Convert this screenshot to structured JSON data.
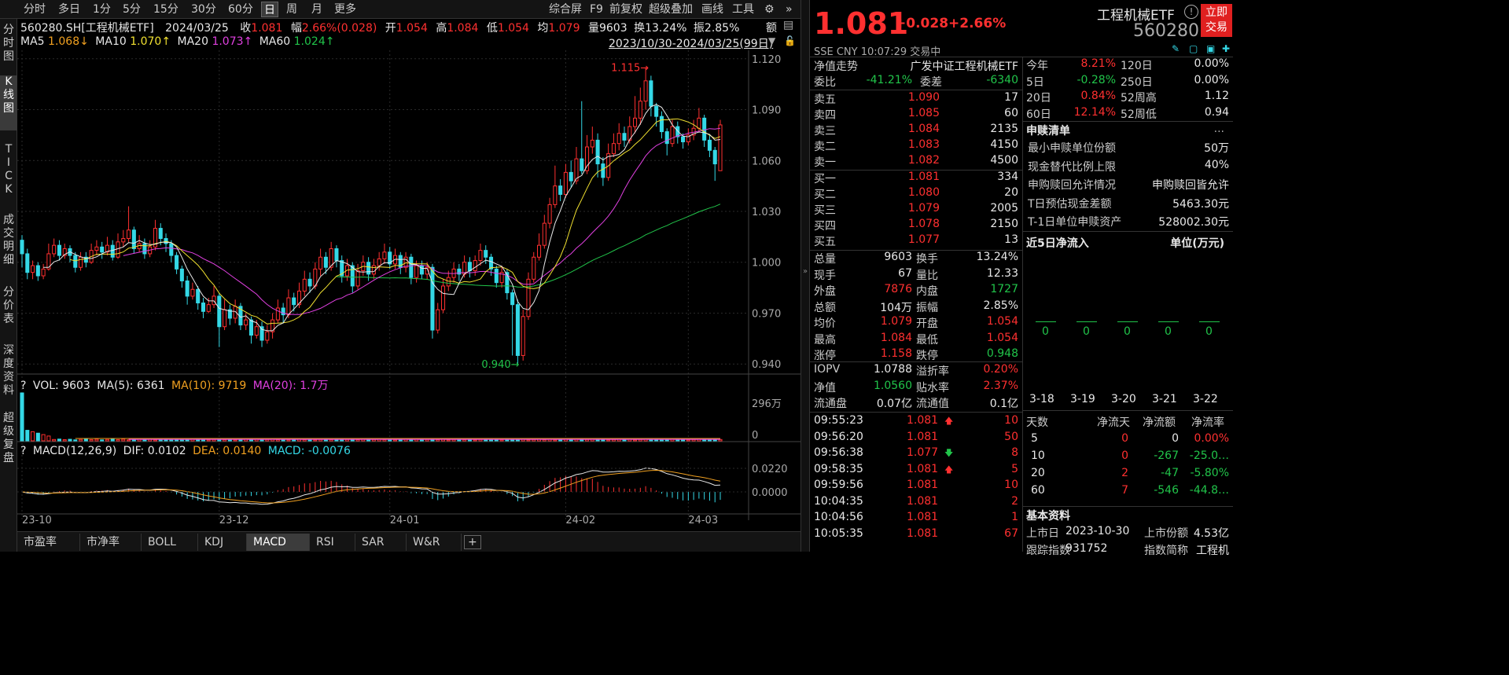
{
  "toolbar": {
    "left_tabs": [
      "分时",
      "多日",
      "1分",
      "5分",
      "15分",
      "30分",
      "60分",
      "日",
      "周",
      "月",
      "更多"
    ],
    "active_tab": "日",
    "right_tabs": [
      "综合屏",
      "F9",
      "前复权",
      "超级叠加",
      "画线",
      "工具"
    ]
  },
  "side_tabs": [
    "分时图",
    "K线图",
    "TICK",
    "成交明细",
    "分价表",
    "深度资料",
    "超级复盘"
  ],
  "quote_line": {
    "code": "560280.SH[工程机械ETF]",
    "date": "2024/03/25",
    "close_label": "收",
    "close": "1.081",
    "amp_label": "幅",
    "amp": "2.66%(0.028)",
    "open_label": "开",
    "open": "1.054",
    "high_label": "高",
    "high": "1.084",
    "low_label": "低",
    "low": "1.054",
    "avg_label": "均",
    "avg": "1.079",
    "vol_label": "量",
    "vol": "9603",
    "turn_label": "换",
    "turn": "13.24%",
    "swing_label": "振",
    "swing": "2.85%",
    "amt_label": "额"
  },
  "ma_line": {
    "ma5": "MA5",
    "ma5_val": "1.068↓",
    "ma10": "MA10",
    "ma10_val": "1.070↑",
    "ma20": "MA20",
    "ma20_val": "1.073↑",
    "ma60": "MA60",
    "ma60_val": "1.024↑",
    "range": "2023/10/30-2024/03/25(99日)"
  },
  "vol_line": {
    "q": "?",
    "vol": "VOL: 9603",
    "ma5": "MA(5): 6361",
    "ma10": "MA(10): 9719",
    "ma20": "MA(20): 1.7万"
  },
  "macd_line": {
    "q": "?",
    "name": "MACD(12,26,9)",
    "dif": "DIF: 0.0102",
    "dea": "DEA: 0.0140",
    "macd": "MACD: -0.0076"
  },
  "bottom_tabs": [
    "市盈率",
    "市净率",
    "BOLL",
    "KDJ",
    "MACD",
    "RSI",
    "SAR",
    "W&R"
  ],
  "active_bottom": "MACD",
  "chart_data": {
    "type": "candlestick",
    "y_ticks": [
      "1.120",
      "1.090",
      "1.060",
      "1.030",
      "1.000",
      "0.970",
      "0.940"
    ],
    "ylim": [
      0.935,
      1.125
    ],
    "x_ticks": [
      "23-10",
      "23-12",
      "24-01",
      "24-02",
      "24-03"
    ],
    "x_tick_index": [
      0,
      37,
      69,
      102,
      125
    ],
    "high_label": "1.115",
    "low_label": "0.940",
    "vol_ticks": [
      "296万",
      "0"
    ],
    "macd_ticks": [
      "0.0220",
      "0.0000"
    ],
    "candles": [
      [
        1.013,
        1.005,
        1.016,
        0.997
      ],
      [
        1.005,
        0.994,
        1.008,
        0.99
      ],
      [
        0.994,
        0.998,
        1.001,
        0.99
      ],
      [
        0.998,
        0.992,
        1.0,
        0.989
      ],
      [
        0.992,
        0.996,
        0.999,
        0.99
      ],
      [
        0.996,
        1.005,
        1.011,
        0.995
      ],
      [
        1.005,
        1.01,
        1.014,
        1.003
      ],
      [
        1.01,
        1.004,
        1.013,
        1.001
      ],
      [
        1.004,
        1.008,
        1.011,
        1.002
      ],
      [
        1.008,
        1.004,
        1.01,
        1.0
      ],
      [
        1.004,
        0.997,
        1.006,
        0.994
      ],
      [
        0.997,
        1.003,
        1.006,
        0.995
      ],
      [
        1.003,
        1.0,
        1.006,
        0.997
      ],
      [
        1.0,
        1.007,
        1.011,
        0.999
      ],
      [
        1.007,
        1.009,
        1.013,
        1.004
      ],
      [
        1.009,
        1.006,
        1.012,
        1.002
      ],
      [
        1.006,
        1.01,
        1.015,
        1.004
      ],
      [
        1.01,
        1.003,
        1.013,
        1.001
      ],
      [
        1.003,
        1.012,
        1.017,
        1.002
      ],
      [
        1.012,
        1.014,
        1.019,
        1.009
      ],
      [
        1.014,
        1.019,
        1.033,
        1.012
      ],
      [
        1.019,
        1.008,
        1.021,
        1.005
      ],
      [
        1.008,
        1.011,
        1.016,
        1.006
      ],
      [
        1.011,
        1.005,
        1.014,
        1.002
      ],
      [
        1.005,
        1.009,
        1.013,
        1.003
      ],
      [
        1.009,
        1.02,
        1.025,
        1.007
      ],
      [
        1.02,
        1.014,
        1.023,
        1.01
      ],
      [
        1.014,
        1.011,
        1.017,
        1.006
      ],
      [
        1.011,
        1.004,
        1.013,
        1.0
      ],
      [
        1.004,
        0.996,
        1.006,
        0.993
      ],
      [
        0.996,
        0.989,
        0.998,
        0.985
      ],
      [
        0.989,
        0.98,
        0.992,
        0.975
      ],
      [
        0.98,
        0.984,
        0.988,
        0.978
      ],
      [
        0.984,
        0.976,
        0.986,
        0.972
      ],
      [
        0.976,
        0.971,
        0.979,
        0.967
      ],
      [
        0.971,
        0.975,
        0.979,
        0.97
      ],
      [
        0.975,
        0.98,
        0.986,
        0.973
      ],
      [
        0.98,
        0.962,
        0.982,
        0.95
      ],
      [
        0.962,
        0.972,
        0.978,
        0.96
      ],
      [
        0.972,
        0.967,
        0.975,
        0.963
      ],
      [
        0.967,
        0.974,
        0.978,
        0.964
      ],
      [
        0.974,
        0.963,
        0.976,
        0.96
      ],
      [
        0.963,
        0.966,
        0.97,
        0.96
      ],
      [
        0.966,
        0.957,
        0.968,
        0.952
      ],
      [
        0.957,
        0.962,
        0.966,
        0.955
      ],
      [
        0.962,
        0.954,
        0.965,
        0.95
      ],
      [
        0.954,
        0.959,
        0.963,
        0.952
      ],
      [
        0.959,
        0.966,
        0.97,
        0.955
      ],
      [
        0.966,
        0.973,
        0.978,
        0.964
      ],
      [
        0.973,
        0.969,
        0.976,
        0.964
      ],
      [
        0.969,
        0.979,
        0.984,
        0.967
      ],
      [
        0.979,
        0.975,
        0.982,
        0.971
      ],
      [
        0.975,
        0.983,
        0.988,
        0.973
      ],
      [
        0.983,
        0.99,
        0.995,
        0.98
      ],
      [
        0.99,
        0.986,
        0.994,
        0.982
      ],
      [
        0.986,
        0.996,
        1.0,
        0.984
      ],
      [
        0.996,
        1.003,
        1.008,
        0.992
      ],
      [
        1.003,
        0.997,
        1.006,
        0.993
      ],
      [
        0.997,
        1.008,
        1.012,
        0.995
      ],
      [
        1.008,
        1.001,
        1.01,
        0.997
      ],
      [
        1.001,
        0.992,
        1.004,
        0.988
      ],
      [
        0.992,
        0.998,
        1.002,
        0.989
      ],
      [
        0.998,
        0.986,
        1.0,
        0.982
      ],
      [
        0.986,
        0.995,
        0.999,
        0.984
      ],
      [
        0.995,
        1.0,
        1.004,
        0.992
      ],
      [
        1.0,
        0.993,
        1.003,
        0.989
      ],
      [
        0.993,
        0.998,
        1.002,
        0.99
      ],
      [
        0.998,
        1.002,
        1.006,
        0.995
      ],
      [
        1.002,
        1.006,
        1.011,
        0.999
      ],
      [
        1.006,
        0.999,
        1.009,
        0.996
      ],
      [
        0.999,
        1.004,
        1.008,
        0.996
      ],
      [
        1.004,
        0.997,
        1.006,
        0.993
      ],
      [
        0.997,
        1.003,
        1.006,
        0.994
      ],
      [
        1.003,
        0.991,
        1.005,
        0.987
      ],
      [
        0.991,
        0.998,
        1.001,
        0.988
      ],
      [
        0.998,
        0.993,
        1.001,
        0.99
      ],
      [
        0.993,
        0.997,
        1.0,
        0.99
      ],
      [
        0.997,
        0.96,
        0.999,
        0.955
      ],
      [
        0.96,
        0.972,
        0.976,
        0.958
      ],
      [
        0.972,
        0.986,
        0.99,
        0.97
      ],
      [
        0.986,
        0.991,
        0.995,
        0.983
      ],
      [
        0.991,
        0.996,
        1.0,
        0.988
      ],
      [
        0.996,
        0.993,
        0.999,
        0.989
      ],
      [
        0.993,
        1.0,
        1.004,
        0.991
      ],
      [
        1.0,
        0.995,
        1.003,
        0.991
      ],
      [
        0.995,
        1.001,
        1.004,
        0.992
      ],
      [
        1.001,
        1.007,
        1.011,
        0.998
      ],
      [
        1.007,
        1.003,
        1.01,
        0.999
      ],
      [
        1.003,
        0.996,
        1.005,
        0.992
      ],
      [
        0.996,
        0.988,
        0.998,
        0.985
      ],
      [
        0.988,
        0.994,
        0.998,
        0.985
      ],
      [
        0.994,
        0.982,
        0.996,
        0.978
      ],
      [
        0.982,
        0.975,
        0.984,
        0.945
      ],
      [
        0.975,
        0.945,
        0.978,
        0.94
      ],
      [
        0.945,
        0.968,
        0.972,
        0.942
      ],
      [
        0.968,
        0.99,
        0.994,
        0.966
      ],
      [
        0.99,
        1.003,
        1.006,
        0.988
      ],
      [
        1.003,
        1.01,
        1.017,
        1.001
      ],
      [
        1.01,
        1.023,
        1.028,
        1.008
      ],
      [
        1.023,
        1.034,
        1.038,
        1.02
      ],
      [
        1.034,
        1.045,
        1.057,
        1.032
      ],
      [
        1.045,
        1.04,
        1.049,
        1.036
      ],
      [
        1.04,
        1.053,
        1.058,
        1.038
      ],
      [
        1.053,
        1.048,
        1.06,
        1.044
      ],
      [
        1.048,
        1.061,
        1.068,
        1.046
      ],
      [
        1.061,
        1.054,
        1.095,
        1.052
      ],
      [
        1.054,
        1.068,
        1.075,
        1.052
      ],
      [
        1.068,
        1.072,
        1.08,
        1.064
      ],
      [
        1.072,
        1.058,
        1.076,
        1.05
      ],
      [
        1.058,
        1.05,
        1.062,
        1.045
      ],
      [
        1.05,
        1.064,
        1.07,
        1.048
      ],
      [
        1.064,
        1.07,
        1.076,
        1.062
      ],
      [
        1.07,
        1.076,
        1.082,
        1.066
      ],
      [
        1.076,
        1.072,
        1.08,
        1.068
      ],
      [
        1.072,
        1.08,
        1.086,
        1.07
      ],
      [
        1.08,
        1.085,
        1.098,
        1.076
      ],
      [
        1.085,
        1.095,
        1.103,
        1.081
      ],
      [
        1.095,
        1.107,
        1.115,
        1.09
      ],
      [
        1.107,
        1.092,
        1.11,
        1.086
      ],
      [
        1.092,
        1.086,
        1.094,
        1.08
      ],
      [
        1.086,
        1.077,
        1.089,
        1.073
      ],
      [
        1.077,
        1.07,
        1.079,
        1.063
      ],
      [
        1.07,
        1.08,
        1.084,
        1.068
      ],
      [
        1.08,
        1.074,
        1.083,
        1.07
      ],
      [
        1.074,
        1.071,
        1.076,
        1.067
      ],
      [
        1.071,
        1.075,
        1.079,
        1.069
      ],
      [
        1.075,
        1.079,
        1.084,
        1.072
      ],
      [
        1.079,
        1.085,
        1.091,
        1.077
      ],
      [
        1.085,
        1.072,
        1.087,
        1.068
      ],
      [
        1.072,
        1.066,
        1.075,
        1.062
      ],
      [
        1.066,
        1.058,
        1.068,
        1.048
      ],
      [
        1.054,
        1.081,
        1.084,
        1.054
      ]
    ]
  },
  "rp": {
    "price": "1.081",
    "change": "+0.028",
    "change_pct": "+2.66%",
    "name": "工程机械ETF",
    "code": "560280",
    "trade_btn": "立即交易",
    "sub": "SSE  CNY  10:07:29  交易中",
    "nav_label": "净值走势",
    "fund_full": "广发中证工程机械ETF",
    "wb_label": "委比",
    "wb": "-41.21%",
    "wc_label": "委差",
    "wc": "-6340",
    "asks": [
      {
        "label": "卖五",
        "price": "1.090",
        "vol": "17"
      },
      {
        "label": "卖四",
        "price": "1.085",
        "vol": "60"
      },
      {
        "label": "卖三",
        "price": "1.084",
        "vol": "2135"
      },
      {
        "label": "卖二",
        "price": "1.083",
        "vol": "4150"
      },
      {
        "label": "卖一",
        "price": "1.082",
        "vol": "4500"
      }
    ],
    "bids": [
      {
        "label": "买一",
        "price": "1.081",
        "vol": "334"
      },
      {
        "label": "买二",
        "price": "1.080",
        "vol": "20"
      },
      {
        "label": "买三",
        "price": "1.079",
        "vol": "2005"
      },
      {
        "label": "买四",
        "price": "1.078",
        "vol": "2150"
      },
      {
        "label": "买五",
        "price": "1.077",
        "vol": "13"
      }
    ],
    "stats": [
      {
        "l1": "总量",
        "v1": "9603",
        "c1": "white",
        "l2": "换手",
        "v2": "13.24%",
        "c2": "white"
      },
      {
        "l1": "现手",
        "v1": "67",
        "c1": "white",
        "l2": "量比",
        "v2": "12.33",
        "c2": "white"
      },
      {
        "l1": "外盘",
        "v1": "7876",
        "c1": "red",
        "l2": "内盘",
        "v2": "1727",
        "c2": "green"
      },
      {
        "l1": "总额",
        "v1": "104万",
        "c1": "white",
        "l2": "振幅",
        "v2": "2.85%",
        "c2": "white"
      },
      {
        "l1": "均价",
        "v1": "1.079",
        "c1": "red",
        "l2": "开盘",
        "v2": "1.054",
        "c2": "red"
      },
      {
        "l1": "最高",
        "v1": "1.084",
        "c1": "red",
        "l2": "最低",
        "v2": "1.054",
        "c2": "red"
      },
      {
        "l1": "涨停",
        "v1": "1.158",
        "c1": "red",
        "l2": "跌停",
        "v2": "0.948",
        "c2": "green"
      }
    ],
    "stats2": [
      {
        "l1": "IOPV",
        "v1": "1.0788",
        "c1": "white",
        "l2": "溢折率",
        "v2": "0.20%",
        "c2": "red"
      },
      {
        "l1": "净值",
        "v1": "1.0560",
        "c1": "green",
        "l2": "贴水率",
        "v2": "2.37%",
        "c2": "red"
      },
      {
        "l1": "流通盘",
        "v1": "0.07亿",
        "c1": "white",
        "l2": "流通值",
        "v2": "0.1亿",
        "c2": "white"
      }
    ],
    "ticks": [
      {
        "t": "09:55:23",
        "p": "1.081",
        "dir": "up",
        "v": "10"
      },
      {
        "t": "09:56:20",
        "p": "1.081",
        "dir": "",
        "v": "50"
      },
      {
        "t": "09:56:38",
        "p": "1.077",
        "dir": "down",
        "v": "8"
      },
      {
        "t": "09:58:35",
        "p": "1.081",
        "dir": "up",
        "v": "5"
      },
      {
        "t": "09:59:56",
        "p": "1.081",
        "dir": "",
        "v": "10"
      },
      {
        "t": "10:04:35",
        "p": "1.081",
        "dir": "",
        "v": "2"
      },
      {
        "t": "10:04:56",
        "p": "1.081",
        "dir": "",
        "v": "1"
      },
      {
        "t": "10:05:35",
        "p": "1.081",
        "dir": "",
        "v": "67"
      }
    ],
    "perf": [
      {
        "l1": "今年",
        "v1": "8.21%",
        "c1": "red",
        "l2": "120日",
        "v2": "0.00%"
      },
      {
        "l1": "5日",
        "v1": "-0.28%",
        "c1": "green",
        "l2": "250日",
        "v2": "0.00%"
      },
      {
        "l1": "20日",
        "v1": "0.84%",
        "c1": "red",
        "l2": "52周高",
        "v2": "1.12"
      },
      {
        "l1": "60日",
        "v1": "12.14%",
        "c1": "red",
        "l2": "52周低",
        "v2": "0.94"
      }
    ],
    "redeem_title": "申赎清单",
    "more": "...",
    "redeem": [
      {
        "l": "最小申赎单位份额",
        "v": "50万"
      },
      {
        "l": "现金替代比例上限",
        "v": "40%"
      },
      {
        "l": "申购赎回允许情况",
        "v": "申购赎回皆允许"
      },
      {
        "l": "T日预估现金差额",
        "v": "5463.30元"
      },
      {
        "l": "T-1日单位申赎资产",
        "v": "528002.30元"
      }
    ],
    "flow_title": "近5日净流入",
    "flow_unit": "单位(万元)",
    "flow_dates": [
      "3-18",
      "3-19",
      "3-20",
      "3-21",
      "3-22"
    ],
    "flow_vals": [
      "0",
      "0",
      "0",
      "0",
      "0"
    ],
    "flow_headers": [
      "天数",
      "净流天",
      "净流额",
      "净流率"
    ],
    "flow_rows": [
      {
        "d": "5",
        "n": "0",
        "a": "0",
        "r": "0.00%",
        "nc": "red",
        "ac": "white",
        "rc": "red"
      },
      {
        "d": "10",
        "n": "0",
        "a": "-267",
        "r": "-25.0…",
        "nc": "red",
        "ac": "green",
        "rc": "green"
      },
      {
        "d": "20",
        "n": "2",
        "a": "-47",
        "r": "-5.80%",
        "nc": "red",
        "ac": "green",
        "rc": "green"
      },
      {
        "d": "60",
        "n": "7",
        "a": "-546",
        "r": "-44.8…",
        "nc": "red",
        "ac": "green",
        "rc": "green"
      }
    ],
    "basic_title": "基本资料",
    "basic": [
      {
        "l1": "上市日",
        "v1": "2023-10-30",
        "l2": "上市份额",
        "v2": "4.53亿"
      },
      {
        "l1": "跟踪指数",
        "v1": "931752",
        "l2": "指数简称",
        "v2": "工程机"
      }
    ]
  },
  "colors": {
    "up": "#ff3030",
    "down": "#34d8e6",
    "ma5": "#e8e8e8",
    "ma10": "#f0e030",
    "ma20": "#e040e0",
    "ma60": "#21c44a",
    "dif": "#e8e8e8",
    "dea": "#f0a020"
  }
}
